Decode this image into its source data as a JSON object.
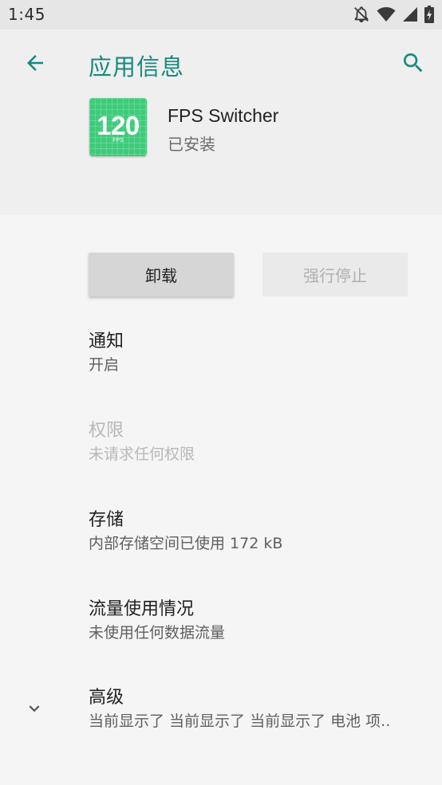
{
  "status_bar": {
    "time": "1:45",
    "icons": [
      "notifications-off-icon",
      "wifi-icon",
      "signal-icon",
      "battery-icon"
    ]
  },
  "app_bar": {
    "title": "应用信息",
    "back_icon": "arrow-left-icon",
    "search_icon": "search-icon"
  },
  "app": {
    "icon_text": "120",
    "icon_unit": "FPS",
    "name": "FPS Switcher",
    "status": "已安装"
  },
  "buttons": {
    "uninstall": "卸载",
    "force_stop": "强行停止"
  },
  "settings": {
    "notifications": {
      "title": "通知",
      "summary": "开启"
    },
    "permissions": {
      "title": "权限",
      "summary": "未请求任何权限"
    },
    "storage": {
      "title": "存储",
      "summary": "内部存储空间已使用 172 kB"
    },
    "data_usage": {
      "title": "流量使用情况",
      "summary": "未使用任何数据流量"
    },
    "advanced": {
      "title": "高级",
      "summary": "当前显示了 当前显示了 当前显示了 电池 项.."
    }
  },
  "colors": {
    "accent": "#16897c",
    "icon_green": "#3ecb7a"
  }
}
